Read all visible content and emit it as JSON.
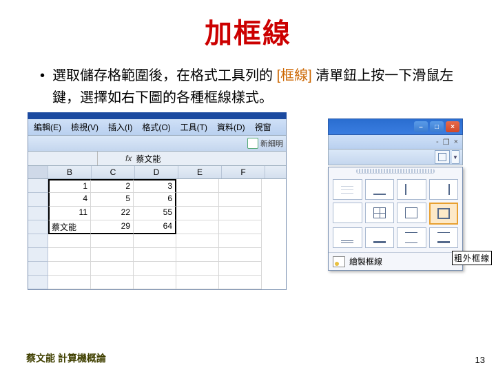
{
  "title": "加框線",
  "bullet": {
    "pre": "選取儲存格範圍後，在格式工具列的 ",
    "hl": "[框線]",
    "post": " 清單鈕上按一下滑鼠左鍵，選擇如右下圖的各種框線樣式。"
  },
  "menus": {
    "edit": "編輯(E)",
    "view": "檢視(V)",
    "insert": "插入(I)",
    "format": "格式(O)",
    "tools": "工具(T)",
    "data": "資料(D)",
    "window": "視窗"
  },
  "newdoc_label": "新細明",
  "fx_value": "蔡文能",
  "columns": [
    "",
    "B",
    "C",
    "D",
    "E",
    "F"
  ],
  "cells": {
    "r1": [
      "1",
      "2",
      "3"
    ],
    "r2": [
      "4",
      "5",
      "6"
    ],
    "r3": [
      "11",
      "22",
      "55"
    ],
    "r4": [
      "蔡文能",
      "29",
      "64"
    ]
  },
  "draw_borders_label": "繪製框線",
  "thick_outer_label": "粗外框線",
  "credit": "蔡文能 計算機概論",
  "page": "13",
  "chart_data": {
    "type": "table",
    "note": "Spreadsheet cells shown in slide",
    "columns": [
      "B",
      "C",
      "D"
    ],
    "rows": [
      [
        1,
        2,
        3
      ],
      [
        4,
        5,
        6
      ],
      [
        11,
        22,
        55
      ],
      [
        "蔡文能",
        29,
        64
      ]
    ]
  }
}
